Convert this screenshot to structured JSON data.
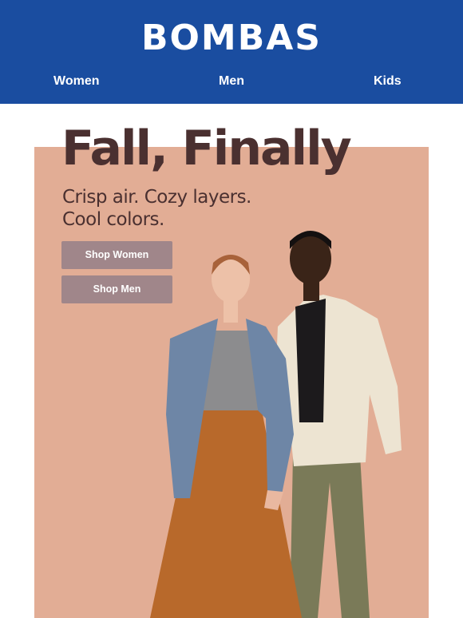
{
  "header": {
    "logo": "BOMBAS",
    "nav": [
      {
        "label": "Women"
      },
      {
        "label": "Men"
      },
      {
        "label": "Kids"
      }
    ]
  },
  "hero": {
    "headline": "Fall, Finally",
    "subline_1": "Crisp air. Cozy layers.",
    "subline_2": "Cool colors.",
    "buttons": [
      {
        "label": "Shop Women"
      },
      {
        "label": "Shop Men"
      }
    ]
  },
  "colors": {
    "header_bg": "#1a4da0",
    "hero_bg": "#e2ad95",
    "headline_text": "#4a3030",
    "button_bg": "#a0868a"
  }
}
